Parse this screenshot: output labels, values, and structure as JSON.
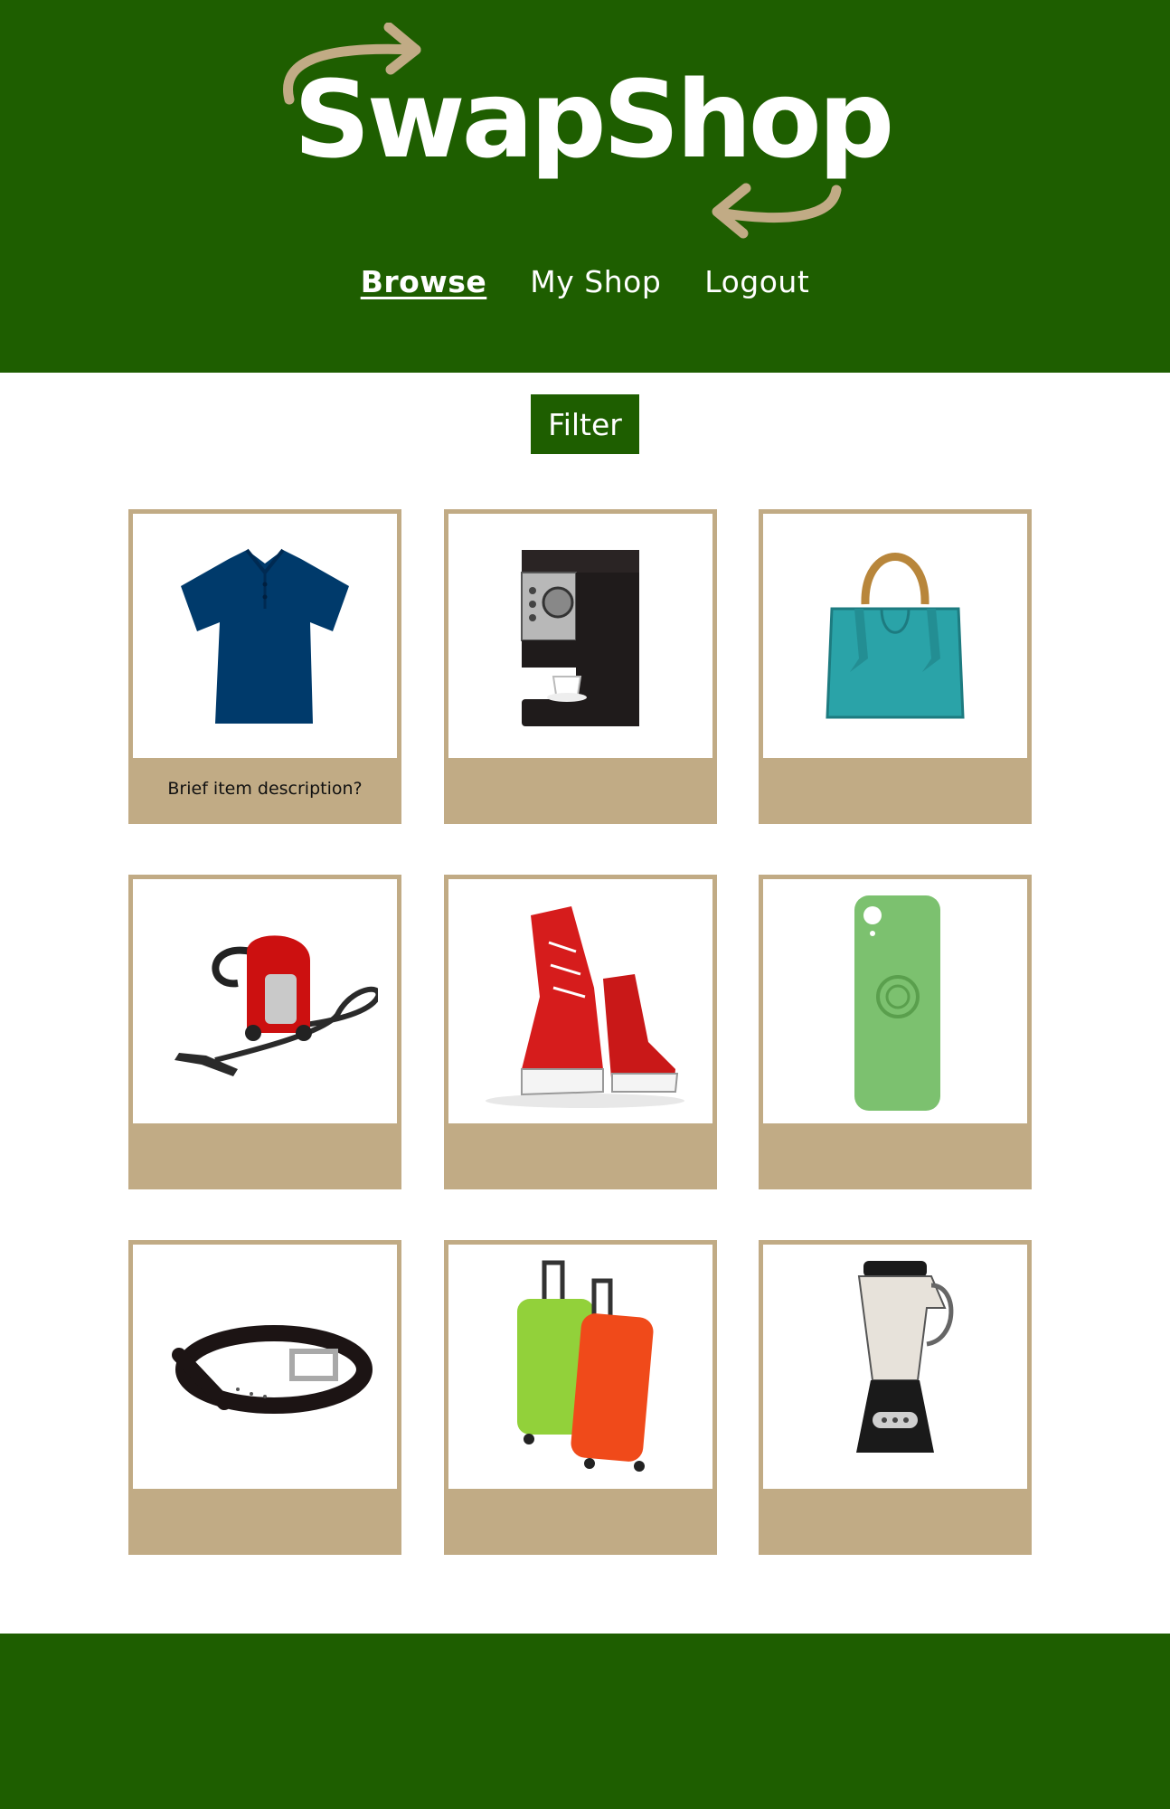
{
  "brand": {
    "name": "SwapShop",
    "primary_color": "#1e5e00",
    "accent_color": "#c1ab85",
    "logo_text_color": "#ffffff"
  },
  "nav": {
    "items": [
      {
        "label": "Browse",
        "active": true
      },
      {
        "label": "My Shop",
        "active": false
      },
      {
        "label": "Logout",
        "active": false
      }
    ]
  },
  "filter": {
    "label": "Filter"
  },
  "items": [
    {
      "icon": "polo-shirt-icon",
      "description": "Brief item description?"
    },
    {
      "icon": "espresso-machine-icon",
      "description": ""
    },
    {
      "icon": "handbag-icon",
      "description": ""
    },
    {
      "icon": "vacuum-cleaner-icon",
      "description": ""
    },
    {
      "icon": "sneakers-icon",
      "description": ""
    },
    {
      "icon": "phone-case-icon",
      "description": ""
    },
    {
      "icon": "belt-icon",
      "description": ""
    },
    {
      "icon": "suitcases-icon",
      "description": ""
    },
    {
      "icon": "blender-icon",
      "description": ""
    }
  ]
}
